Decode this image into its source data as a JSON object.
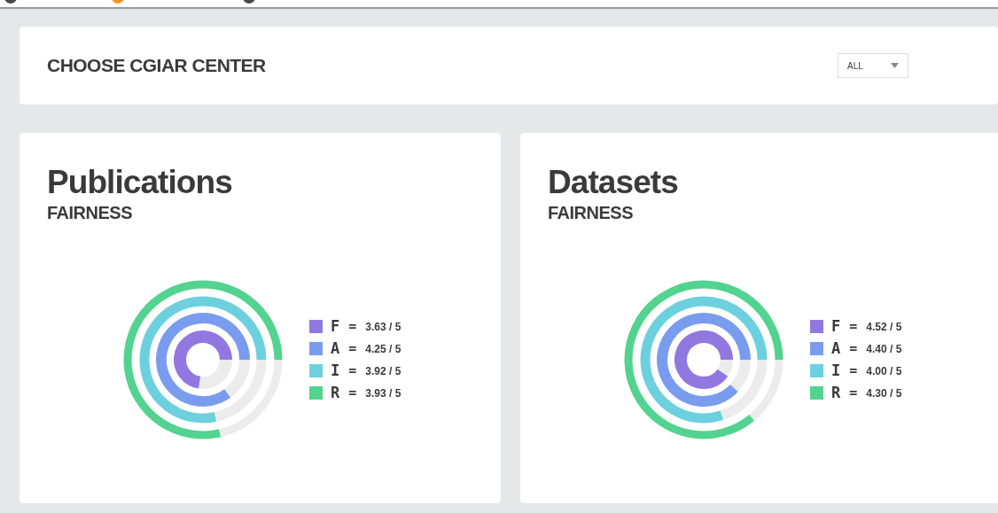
{
  "filter": {
    "title": "CHOOSE CGIAR CENTER",
    "select": {
      "value": "ALL"
    }
  },
  "panels": [
    {
      "title": "Publications",
      "subtitle": "FAIRNESS",
      "rings": [
        {
          "letter": "F",
          "equals": "=",
          "value": "3.63 / 5",
          "color": "#9178e0"
        },
        {
          "letter": "A",
          "equals": "=",
          "value": "4.25 / 5",
          "color": "#7a9cef"
        },
        {
          "letter": "I",
          "equals": "=",
          "value": "3.92 / 5",
          "color": "#6dd0df"
        },
        {
          "letter": "R",
          "equals": "=",
          "value": "3.93 / 5",
          "color": "#52d38f"
        }
      ]
    },
    {
      "title": "Datasets",
      "subtitle": "FAIRNESS",
      "rings": [
        {
          "letter": "F",
          "equals": "=",
          "value": "4.52 / 5",
          "color": "#9178e0"
        },
        {
          "letter": "A",
          "equals": "=",
          "value": "4.40 / 5",
          "color": "#7a9cef"
        },
        {
          "letter": "I",
          "equals": "=",
          "value": "4.00 / 5",
          "color": "#6dd0df"
        },
        {
          "letter": "R",
          "equals": "=",
          "value": "4.30 / 5",
          "color": "#52d38f"
        }
      ]
    }
  ]
}
